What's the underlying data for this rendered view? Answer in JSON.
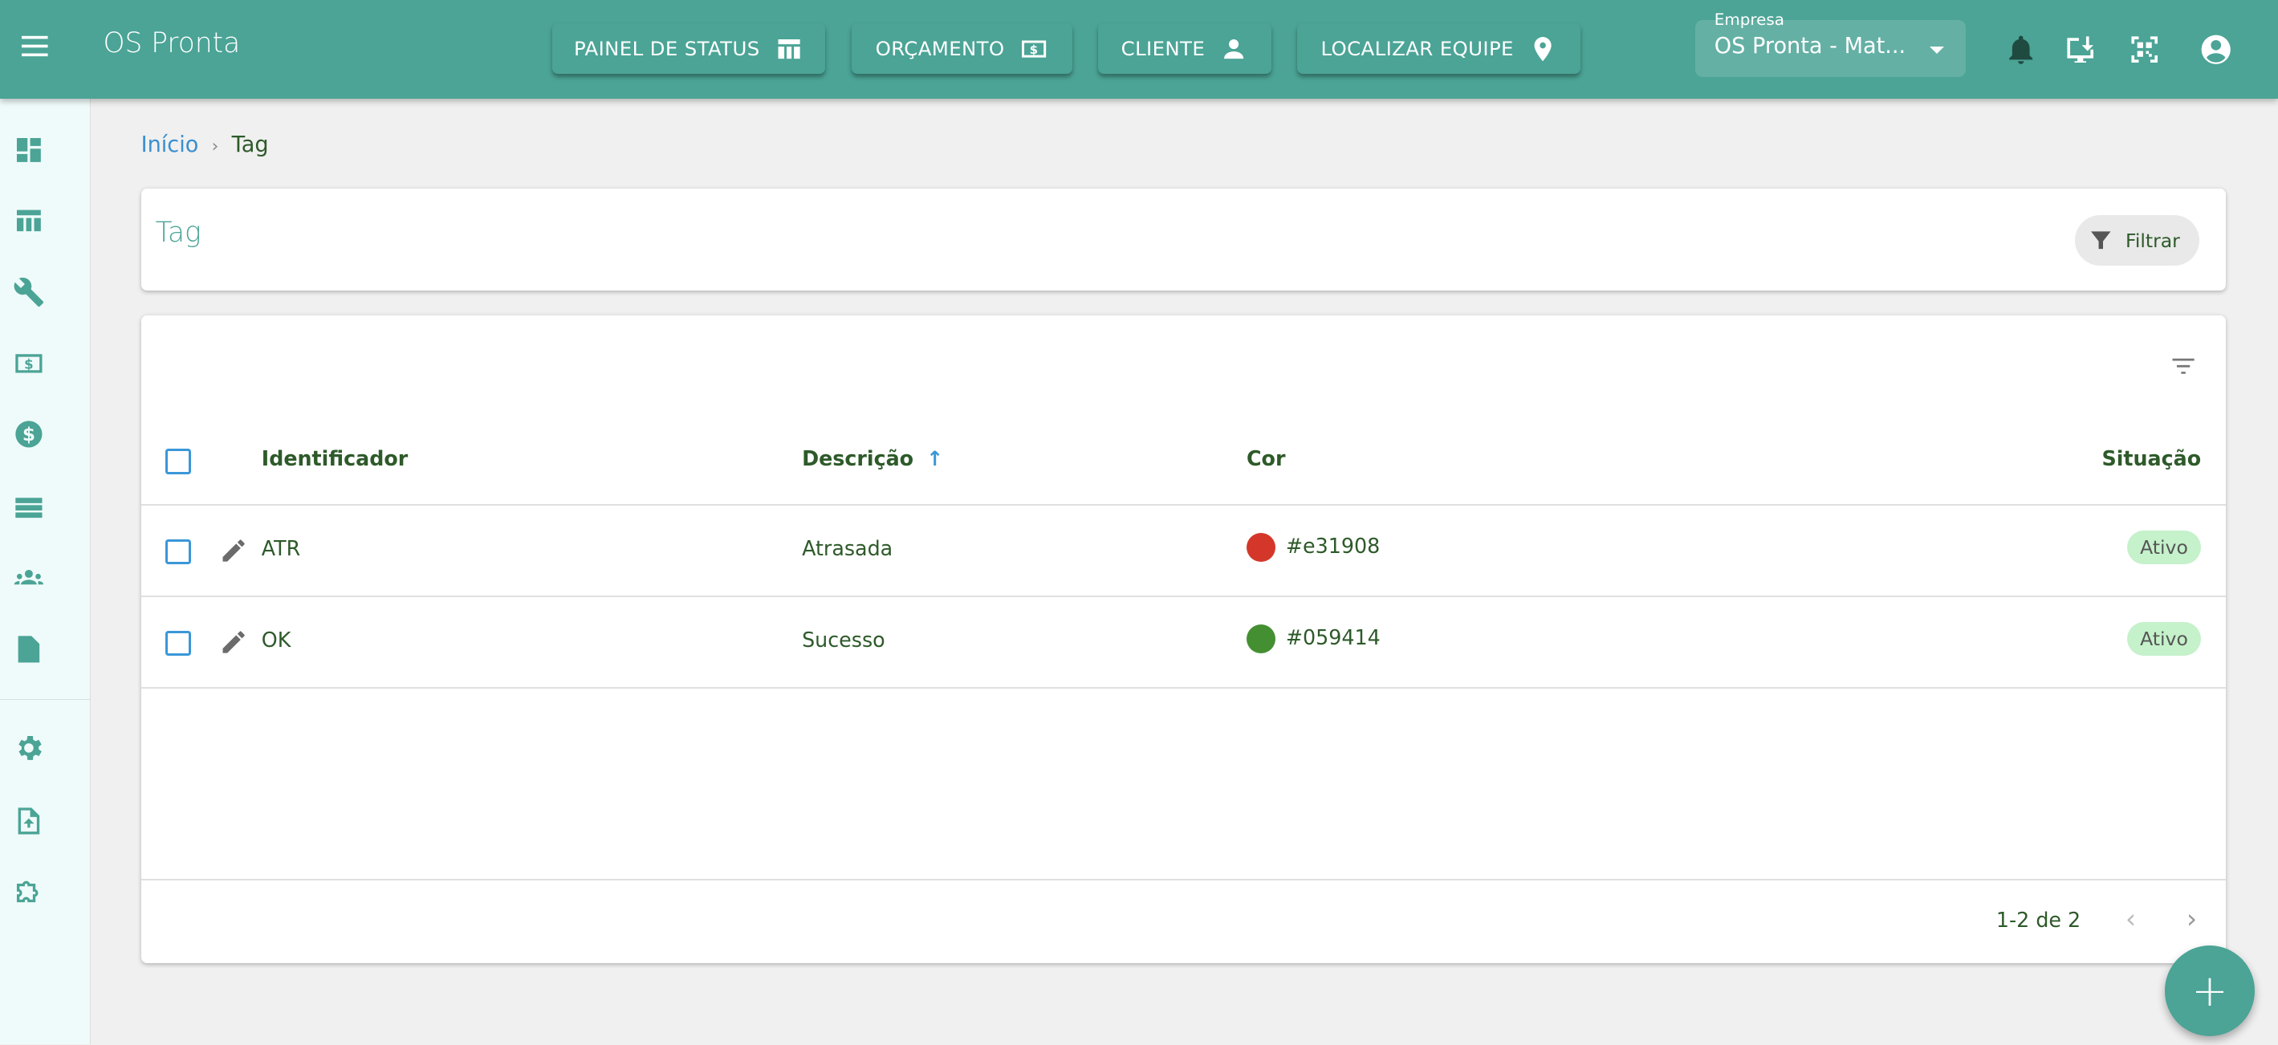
{
  "header": {
    "app_title": "OS Pronta",
    "buttons": [
      {
        "label": "PAINEL DE STATUS",
        "icon": "table-icon"
      },
      {
        "label": "ORÇAMENTO",
        "icon": "money-icon"
      },
      {
        "label": "CLIENTE",
        "icon": "person-icon"
      },
      {
        "label": "LOCALIZAR EQUIPE",
        "icon": "location-pin-icon"
      }
    ],
    "company_select": {
      "label": "Empresa",
      "value": "OS Pronta - Mat..."
    }
  },
  "breadcrumb": {
    "home": "Início",
    "separator": "›",
    "current": "Tag"
  },
  "page": {
    "title": "Tag",
    "filter_button": "Filtrar"
  },
  "table": {
    "columns": [
      "Identificador",
      "Descrição",
      "Cor",
      "Situação"
    ],
    "rows": [
      {
        "id": "ATR",
        "description": "Atrasada",
        "color": "#e31908",
        "status": "Ativo"
      },
      {
        "id": "OK",
        "description": "Sucesso",
        "color": "#059414",
        "status": "Ativo"
      }
    ],
    "pagination": "1-2 de 2"
  },
  "colors": {
    "primary": "#4ba496",
    "red_dot": "#d4372a",
    "green_dot": "#448f32"
  }
}
